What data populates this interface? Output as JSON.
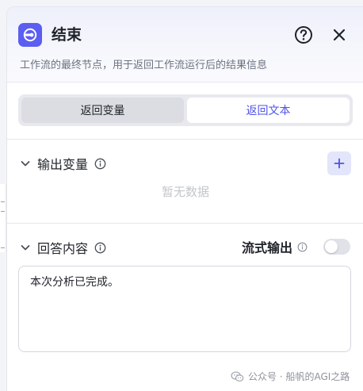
{
  "node": {
    "title": "结束",
    "description": "工作流的最终节点，用于返回工作流运行后的结果信息"
  },
  "segment": {
    "tabs": [
      {
        "label": "返回变量",
        "active": false
      },
      {
        "label": "返回文本",
        "active": true
      }
    ]
  },
  "output_section": {
    "title": "输出变量",
    "empty_text": "暂无数据"
  },
  "answer_section": {
    "title": "回答内容",
    "stream_label": "流式输出",
    "stream_enabled": false,
    "content": "本次分析已完成。"
  },
  "watermark": {
    "text": "公众号 · 船帆的AGI之路"
  },
  "colors": {
    "accent": "#5b5ef0",
    "active_tab_text": "#4f52e6",
    "add_button_bg": "#e3e5fb"
  },
  "icons": [
    "end-node-icon",
    "help-icon",
    "close-icon",
    "chevron-down-icon",
    "info-icon",
    "plus-icon",
    "wechat-icon"
  ]
}
